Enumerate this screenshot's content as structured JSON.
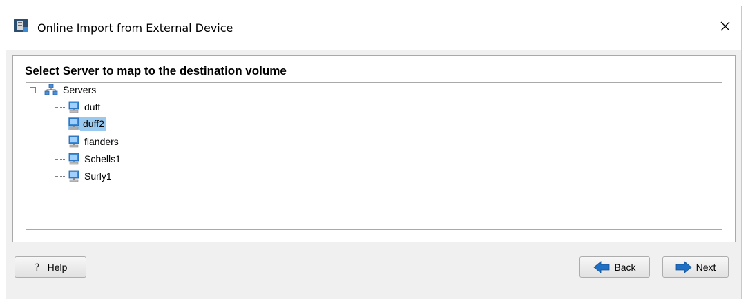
{
  "window": {
    "title": "Online Import from External Device"
  },
  "page": {
    "heading": "Select Server to map to the destination volume"
  },
  "tree": {
    "root": {
      "label": "Servers",
      "expanded": true,
      "icon": "servers-network-icon"
    },
    "nodes": [
      {
        "label": "duff",
        "selected": false,
        "icon": "computer-icon"
      },
      {
        "label": "duff2",
        "selected": true,
        "icon": "computer-icon"
      },
      {
        "label": "flanders",
        "selected": false,
        "icon": "computer-icon"
      },
      {
        "label": "Schells1",
        "selected": false,
        "icon": "computer-icon"
      },
      {
        "label": "Surly1",
        "selected": false,
        "icon": "computer-icon"
      }
    ]
  },
  "buttons": {
    "help": "Help",
    "back": "Back",
    "next": "Next"
  },
  "colors": {
    "selection": "#99c9ef",
    "arrow": "#1f6fc5"
  }
}
